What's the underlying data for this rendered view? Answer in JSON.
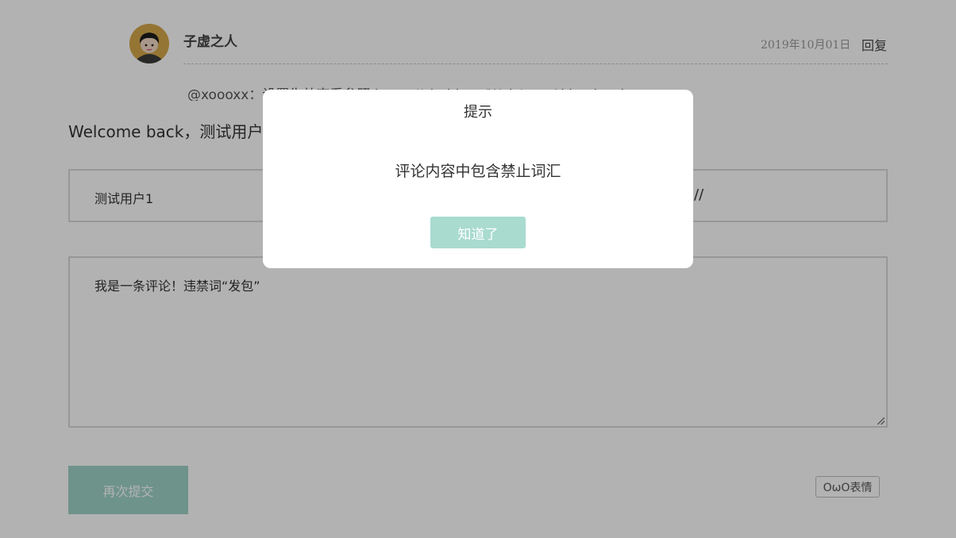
{
  "comment": {
    "author": "子虚之人",
    "date": "2019年10月01日",
    "reply_label": "回复",
    "text": "@xoooxx：设置失效查看参照 https://zhebk.cn/Web/userAkina.html"
  },
  "form": {
    "welcome": "Welcome back，测试用户1",
    "name_value": "测试用户1",
    "right_value": "//",
    "comment_value": "我是一条评论！违禁词“发包”",
    "submit_label": "再次提交",
    "emoji_label": "OωO表情"
  },
  "dialog": {
    "title": "提示",
    "message": "评论内容中包含禁止词汇",
    "confirm_label": "知道了"
  },
  "colors": {
    "accent": "#9ed3c8",
    "overlay": "rgba(0,0,0,0.30)"
  }
}
